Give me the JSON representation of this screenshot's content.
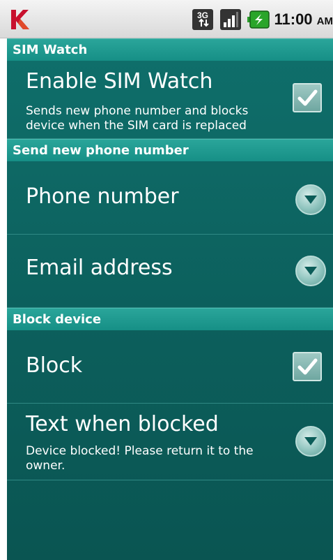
{
  "status_bar": {
    "network_label": "3G",
    "time": "11:00",
    "ampm": "AM",
    "icons": [
      "kaspersky-logo-icon",
      "3g-network-icon",
      "signal-strength-icon",
      "battery-charging-icon"
    ]
  },
  "sections": {
    "sim_watch": {
      "header": "SIM Watch",
      "enable_title": "Enable SIM Watch",
      "enable_desc": "Sends new phone number and blocks device when the SIM card is replaced",
      "enable_checked": true
    },
    "send_number": {
      "header": "Send new phone number",
      "phone_label": "Phone number",
      "email_label": "Email address"
    },
    "block_device": {
      "header": "Block device",
      "block_label": "Block",
      "block_checked": true,
      "text_title": "Text when blocked",
      "text_value": "Device blocked! Please return it to the owner."
    }
  },
  "colors": {
    "background": "#0c5f5c",
    "header": "#1c988e",
    "statusbar": "#e6e6e6"
  }
}
